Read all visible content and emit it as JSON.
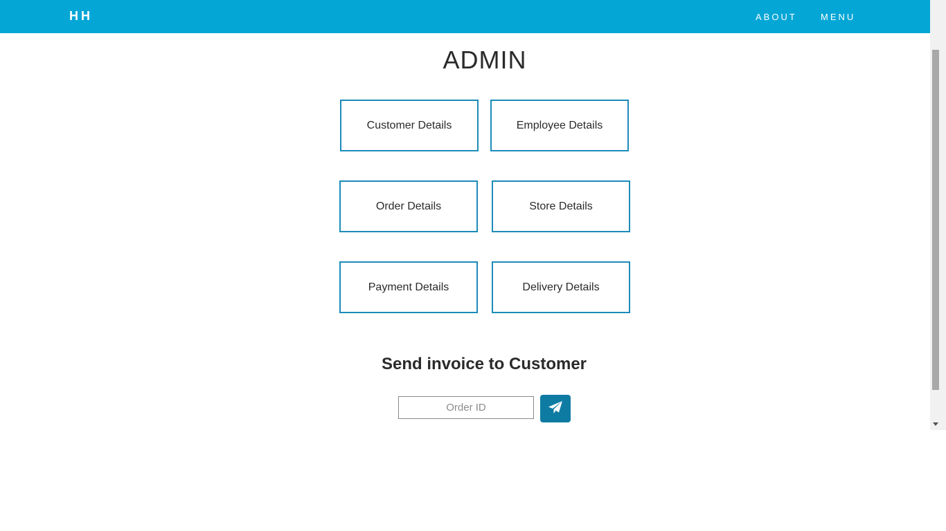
{
  "navbar": {
    "brand": "HH",
    "links": [
      "ABOUT",
      "MENU"
    ],
    "background_color": "#04a6d6"
  },
  "page": {
    "title": "ADMIN"
  },
  "detail_buttons": [
    "Customer Details",
    "Employee Details",
    "Order Details",
    "Store Details",
    "Payment Details",
    "Delivery Details"
  ],
  "invoice": {
    "heading": "Send invoice to Customer",
    "input_placeholder": "Order ID",
    "input_value": "",
    "send_icon": "paper-plane-icon",
    "send_button_color": "#0e7ba3"
  },
  "colors": {
    "accent": "#04a6d6",
    "button_border": "#1b8bb8"
  }
}
